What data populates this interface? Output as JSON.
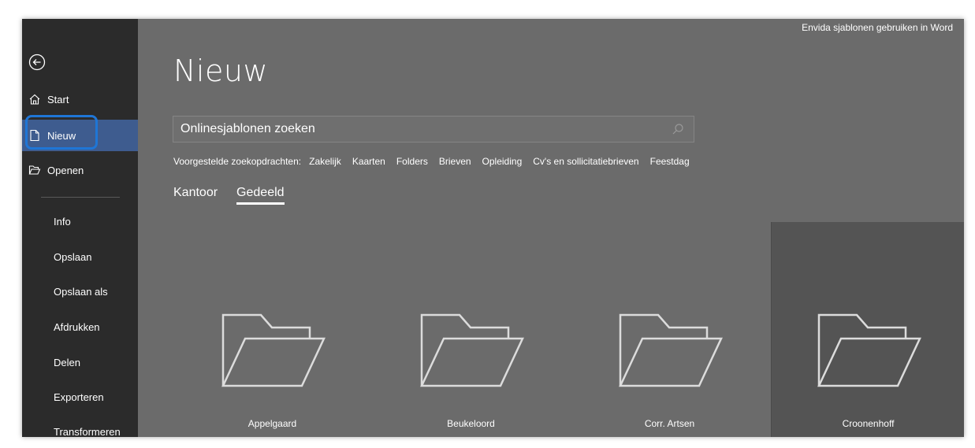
{
  "window": {
    "title": "Envida sjablonen gebruiken in Word"
  },
  "sidebar": {
    "start": "Start",
    "new": "Nieuw",
    "open": "Openen",
    "items": [
      "Info",
      "Opslaan",
      "Opslaan als",
      "Afdrukken",
      "Delen",
      "Exporteren",
      "Transformeren"
    ]
  },
  "main": {
    "title": "Nieuw",
    "search_placeholder": "Onlinesjablonen zoeken",
    "suggested_label": "Voorgestelde zoekopdrachten:",
    "suggested": [
      "Zakelijk",
      "Kaarten",
      "Folders",
      "Brieven",
      "Opleiding",
      "Cv's en sollicitatiebrieven",
      "Feestdag"
    ],
    "tabs": [
      "Kantoor",
      "Gedeeld"
    ],
    "active_tab": "Gedeeld",
    "folders": [
      "Appelgaard",
      "Beukeloord",
      "Corr. Artsen",
      "Croonenhoff"
    ],
    "selected_folder": "Croonenhoff"
  },
  "colors": {
    "sidebar_bg": "#2b2b2b",
    "main_bg": "#6b6b6b",
    "selected_nav": "#3e5c8f",
    "highlight_border": "#1f76d6",
    "selected_tile": "#545454"
  }
}
